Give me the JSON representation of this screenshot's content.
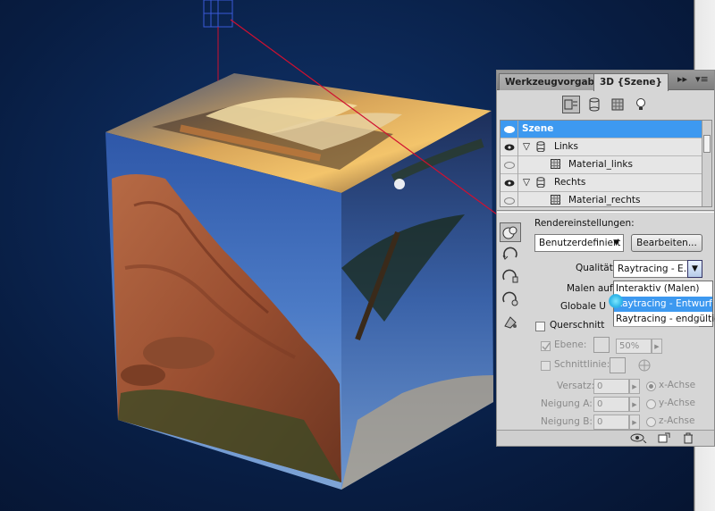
{
  "panel": {
    "tabs": [
      {
        "label": "Werkzeugvorgaben",
        "active": false
      },
      {
        "label": "3D {Szene}",
        "active": true
      }
    ],
    "tab_controls": {
      "collapse": "▸▸",
      "menu": "▾≡"
    },
    "toolbar_icons": [
      "scene-icon",
      "mesh-icon",
      "material-icon",
      "light-icon"
    ],
    "tree": {
      "rows": [
        {
          "label": "Szene",
          "selected": true,
          "level": 0
        },
        {
          "label": "Links",
          "level": 1,
          "expanded": true
        },
        {
          "label": "Material_links",
          "level": 2
        },
        {
          "label": "Rechts",
          "level": 1,
          "expanded": true
        },
        {
          "label": "Material_rechts",
          "level": 2
        }
      ]
    },
    "render": {
      "heading": "Rendereinstellungen:",
      "preset_value": "Benutzerdefiniert",
      "edit_button": "Bearbeiten...",
      "quality_label": "Qualität:",
      "quality_value": "Raytracing - E...",
      "paint_on_label": "Malen auf:",
      "global_label": "Globale U",
      "quality_options": [
        {
          "label": "Interaktiv (Malen)",
          "highlighted": false
        },
        {
          "label": "Raytracing - Entwurf",
          "highlighted": true
        },
        {
          "label": "Raytracing - endgültig",
          "highlighted": false
        }
      ]
    },
    "cross_section": {
      "label": "Querschnitt",
      "plane_label": "Ebene:",
      "plane_percent": "50%",
      "intersection_label": "Schnittlinie:",
      "offset_label": "Versatz:",
      "offset_value": "0",
      "tilt_a_label": "Neigung A:",
      "tilt_a_value": "0",
      "tilt_b_label": "Neigung B:",
      "tilt_b_value": "0",
      "axes": [
        {
          "label": "x-Achse",
          "selected": true
        },
        {
          "label": "y-Achse",
          "selected": false
        },
        {
          "label": "z-Achse",
          "selected": false
        }
      ]
    },
    "status_icons": [
      "visibility-toggle-icon",
      "new-item-icon",
      "trash-icon"
    ]
  },
  "colors": {
    "background": "#0d2a5a",
    "selection": "#3d99f0",
    "guide_line": "#d01030",
    "panel": "#d6d6d6"
  }
}
